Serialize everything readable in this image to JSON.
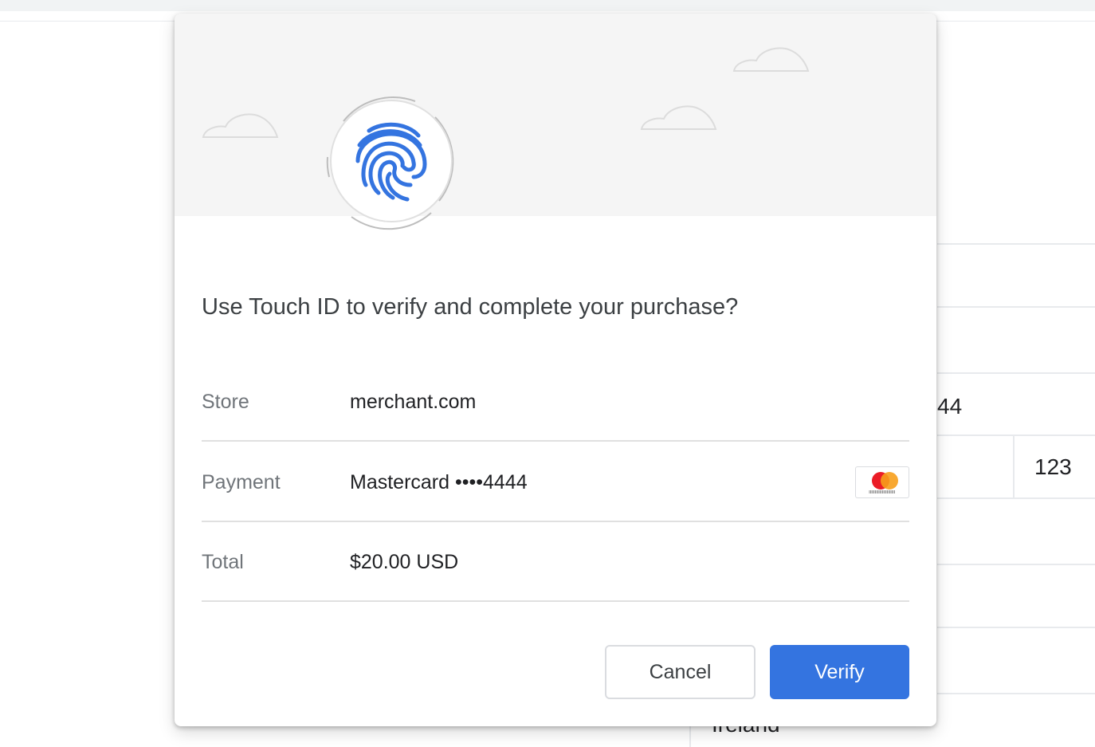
{
  "background": {
    "card_fragment": "44",
    "cvc_value": "123",
    "country_value": "Ireland"
  },
  "dialog": {
    "question": "Use Touch ID to verify and complete your purchase?",
    "rows": [
      {
        "label": "Store",
        "value": "merchant.com"
      },
      {
        "label": "Payment",
        "value": "Mastercard ••••4444",
        "card_brand_icon": "mastercard-icon"
      },
      {
        "label": "Total",
        "value": "$20.00 USD"
      }
    ],
    "buttons": {
      "cancel": "Cancel",
      "verify": "Verify"
    },
    "fingerprint_icon": "fingerprint-icon"
  },
  "colors": {
    "accent": "#3474e0",
    "header_bg": "#f5f5f5",
    "mastercard_red": "#eb1c26",
    "mastercard_orange": "#f79e1b"
  }
}
